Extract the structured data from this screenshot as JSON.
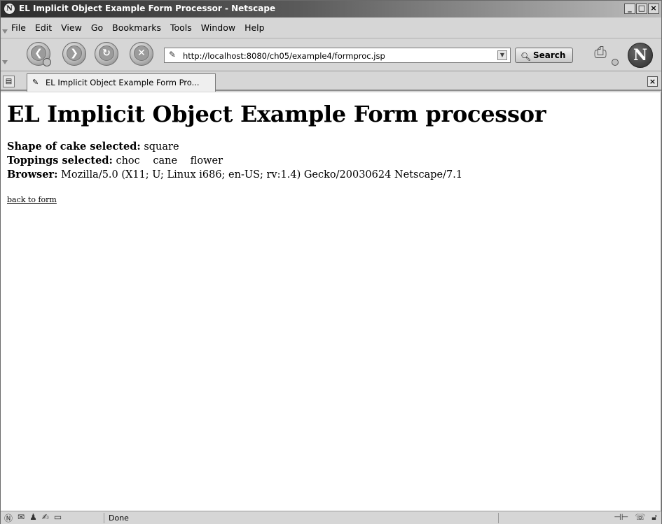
{
  "window": {
    "title": "EL Implicit Object Example Form Processor - Netscape",
    "app_icon": "N",
    "controls": {
      "minimize": "_",
      "maximize": "□",
      "close": "×"
    }
  },
  "menu": {
    "items": [
      "File",
      "Edit",
      "View",
      "Go",
      "Bookmarks",
      "Tools",
      "Window",
      "Help"
    ]
  },
  "nav": {
    "back_icon": "back-arrow-icon",
    "forward_icon": "forward-arrow-icon",
    "reload_icon": "reload-icon",
    "stop_icon": "stop-icon",
    "url": "http://localhost:8080/ch05/example4/formproc.jsp",
    "search_label": "Search",
    "throbber_letter": "N"
  },
  "tab": {
    "label": "EL Implicit Object Example Form Pro..."
  },
  "page": {
    "heading": "EL Implicit Object Example Form processor",
    "shape_label": "Shape of cake selected:",
    "shape_value": "square",
    "toppings_label": "Toppings selected:",
    "toppings": [
      "choc",
      "cane",
      "flower"
    ],
    "browser_label": "Browser:",
    "browser_value": "Mozilla/5.0 (X11; U; Linux i686; en-US; rv:1.4) Gecko/20030624 Netscape/7.1",
    "back_link": "back to form"
  },
  "status": {
    "text": "Done"
  }
}
